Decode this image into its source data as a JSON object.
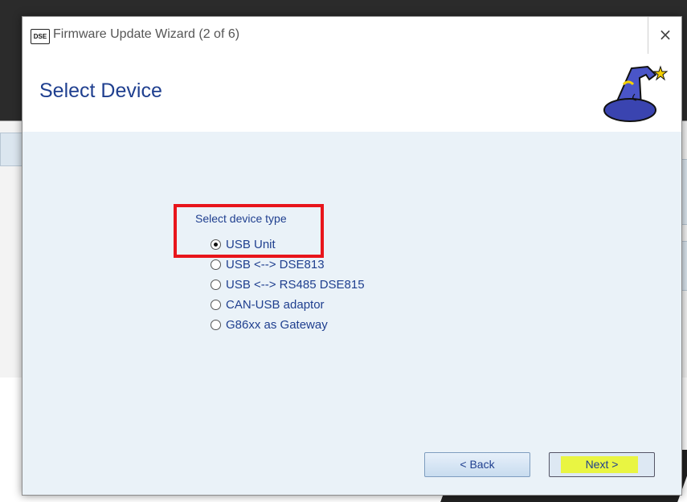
{
  "window": {
    "app_icon_text": "DSE",
    "title": "Firmware Update Wizard (2 of 6)",
    "close_glyph": "×"
  },
  "header": {
    "title": "Select Device",
    "icon": "wizard-hat-icon"
  },
  "device_select": {
    "label": "Select device type",
    "options": [
      {
        "label": "USB Unit",
        "selected": true
      },
      {
        "label": "USB <--> DSE813",
        "selected": false
      },
      {
        "label": "USB <--> RS485 DSE815",
        "selected": false
      },
      {
        "label": "CAN-USB adaptor",
        "selected": false
      },
      {
        "label": "G86xx as Gateway",
        "selected": false
      }
    ]
  },
  "buttons": {
    "back": "< Back",
    "next": "Next >"
  },
  "annotations": {
    "highlight_color": "#e8151b",
    "next_highlight_color": "#e9f542"
  },
  "colors": {
    "accent_text": "#1f3f8f",
    "dialog_bg": "#eaf2f8"
  }
}
